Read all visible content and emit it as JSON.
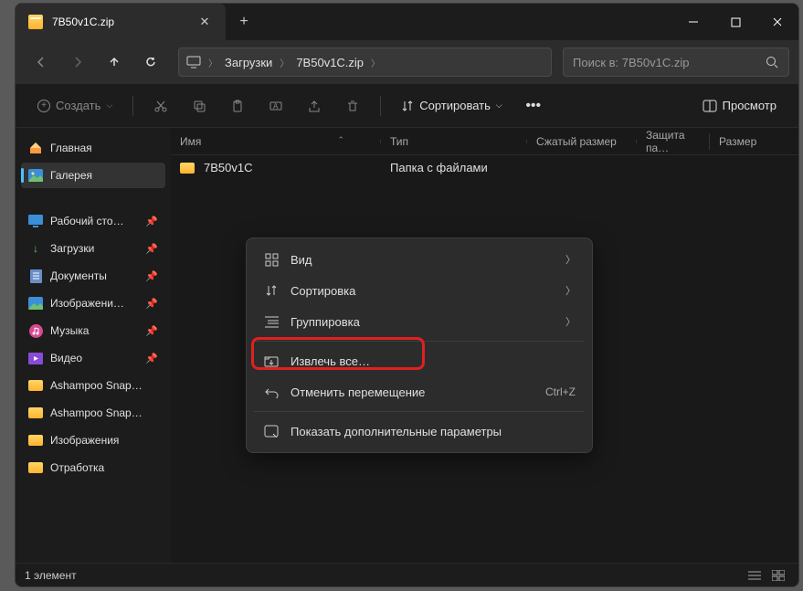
{
  "tab": {
    "title": "7B50v1C.zip"
  },
  "breadcrumb": {
    "part1": "Загрузки",
    "part2": "7B50v1C.zip"
  },
  "search": {
    "placeholder": "Поиск в: 7B50v1C.zip"
  },
  "actions": {
    "create": "Создать",
    "sort": "Сортировать",
    "view": "Просмотр"
  },
  "columns": {
    "name": "Имя",
    "type": "Тип",
    "compressed": "Сжатый размер",
    "protected": "Защита па…",
    "size": "Размер"
  },
  "row": {
    "name": "7B50v1C",
    "type": "Папка с файлами"
  },
  "sidebar": {
    "home": "Главная",
    "gallery": "Галерея",
    "desktop": "Рабочий сто…",
    "downloads": "Загрузки",
    "documents": "Документы",
    "pictures": "Изображени…",
    "music": "Музыка",
    "videos": "Видео",
    "snap1": "Ashampoo Snap…",
    "snap2": "Ashampoo Snap…",
    "images": "Изображения",
    "work": "Отработка"
  },
  "context": {
    "view": "Вид",
    "sort": "Сортировка",
    "group": "Группировка",
    "extract": "Извлечь все…",
    "undo": "Отменить перемещение",
    "undo_short": "Ctrl+Z",
    "more": "Показать дополнительные параметры"
  },
  "status": {
    "count": "1 элемент"
  }
}
